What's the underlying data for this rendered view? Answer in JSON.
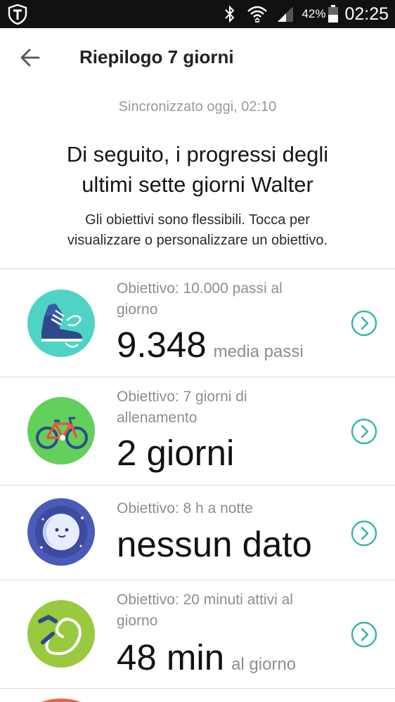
{
  "status_bar": {
    "battery_percent": "42%",
    "time": "02:25"
  },
  "header": {
    "title": "Riepilogo 7 giorni"
  },
  "summary": {
    "sync_text": "Sincronizzato oggi, 02:10",
    "headline_line1": "Di seguito, i progressi degli",
    "headline_line2": "ultimi sette giorni Walter",
    "subline_line1": "Gli obiettivi sono flessibili. Tocca per",
    "subline_line2": "visualizzare o personalizzare un obiettivo."
  },
  "goals": [
    {
      "icon": "steps-shoe-icon",
      "icon_bg": "#4fd3c4",
      "goal_line1": "Obiettivo: 10.000 passi al",
      "goal_line2": "giorno",
      "value": "9.348",
      "unit": "media passi"
    },
    {
      "icon": "bicycle-icon",
      "icon_bg": "#62d05b",
      "goal_line1": "Obiettivo: 7 giorni di",
      "goal_line2": "allenamento",
      "value": "2 giorni",
      "unit": ""
    },
    {
      "icon": "moon-sleep-icon",
      "icon_bg": "#4a5bb8",
      "goal_line1": "Obiettivo: 8 h a notte",
      "goal_line2": "",
      "value": "nessun dato",
      "unit": ""
    },
    {
      "icon": "active-minutes-icon",
      "icon_bg": "#99c93f",
      "goal_line1": "Obiettivo: 20 minuti attivi al",
      "goal_line2": "giorno",
      "value": "48 min",
      "unit": "al giorno"
    }
  ],
  "colors": {
    "accent_teal": "#35b5ad",
    "status_bar_bg": "#111111"
  }
}
